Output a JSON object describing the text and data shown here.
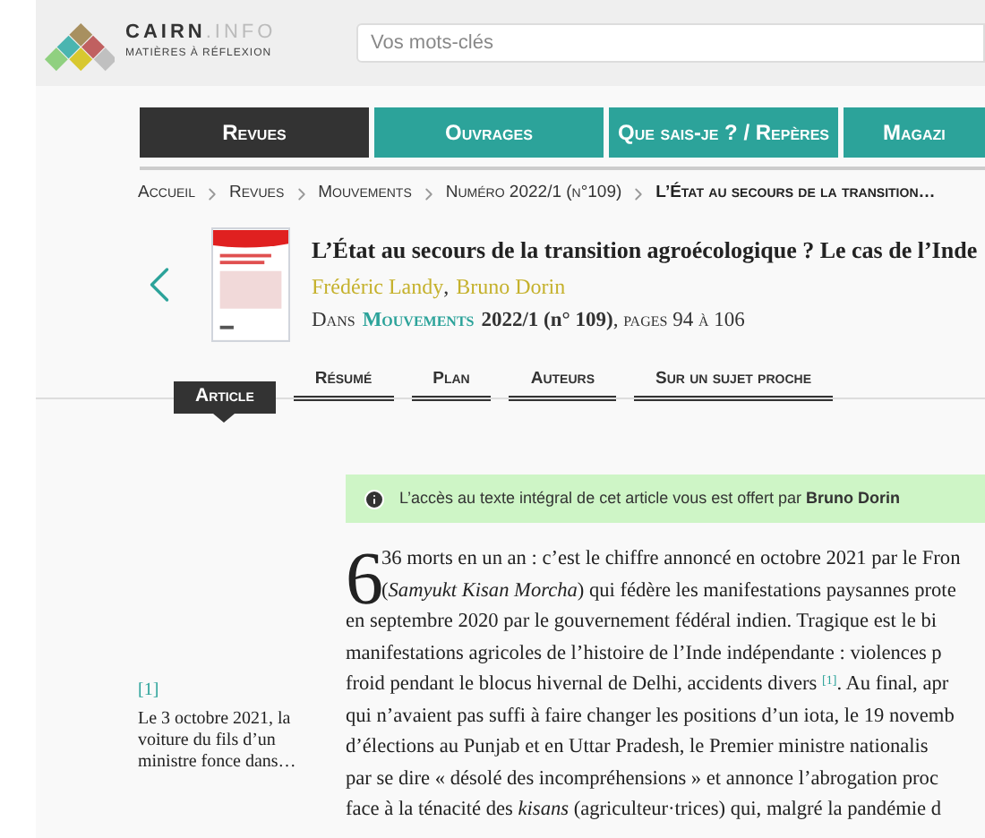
{
  "logo": {
    "name": "CAIRN",
    "suffix": ".INFO",
    "tagline": "MATIÈRES À RÉFLEXION"
  },
  "search": {
    "placeholder": "Vos mots-clés"
  },
  "nav": [
    {
      "label": "Revues",
      "selected": true
    },
    {
      "label": "Ouvrages",
      "selected": false
    },
    {
      "label": "Que sais-je ? / Repères",
      "selected": false
    },
    {
      "label": "Magazi",
      "selected": false
    }
  ],
  "breadcrumb": [
    {
      "label": "Accueil",
      "current": false
    },
    {
      "label": "Revues",
      "current": false
    },
    {
      "label": "Mouvements",
      "current": false
    },
    {
      "label": "Numéro 2022/1 (n°109)",
      "current": false
    },
    {
      "label": "L’État au secours de la transition…",
      "current": true
    }
  ],
  "article": {
    "title": "L’État au secours de la transition agroécologique ? Le cas de l’Inde",
    "authors": [
      "Frédéric Landy",
      "Bruno Dorin"
    ],
    "author_separator": ",",
    "in_prefix": "Dans",
    "journal": "Mouvements",
    "issue": "2022/1 (n° 109)",
    "pages": ", pages 94 à 106"
  },
  "tabs": [
    {
      "label": "Article",
      "selected": true
    },
    {
      "label": "Résumé",
      "selected": false
    },
    {
      "label": "Plan",
      "selected": false
    },
    {
      "label": "Auteurs",
      "selected": false
    },
    {
      "label": "Sur un sujet proche",
      "selected": false
    }
  ],
  "notice": {
    "text": "L’accès au texte intégral de cet article vous est offert par **Bruno Dorin**"
  },
  "footnote": {
    "ref": "[1]",
    "text": "Le 3 octobre 2021, la voiture du fils d’un ministre fonce dans…"
  },
  "body": {
    "drop_cap": "6",
    "lines": [
      "36 morts en un an : c’est le chiffre annoncé en octobre 2021 par le Fron",
      "(*Samyukt Kisan Morcha*) qui fédère les manifestations paysannes prote",
      "en septembre 2020 par le gouvernement fédéral indien. Tragique est le bi",
      "manifestations agricoles de l’histoire de l’Inde indépendante : violences p",
      "froid pendant le blocus hivernal de Delhi, accidents divers $^{[1]}$. Au final, apr",
      "qui n’avaient pas suffi à faire changer les positions d’un iota, le 19 novemb",
      "d’élections au Punjab et en Uttar Pradesh, le Premier ministre nationalis",
      "par se dire « désolé des incompréhensions » et annonce l’abrogation proc",
      "face à la ténacité des *kisans* (agriculteur·trices) qui, malgré la pandémie d"
    ]
  }
}
